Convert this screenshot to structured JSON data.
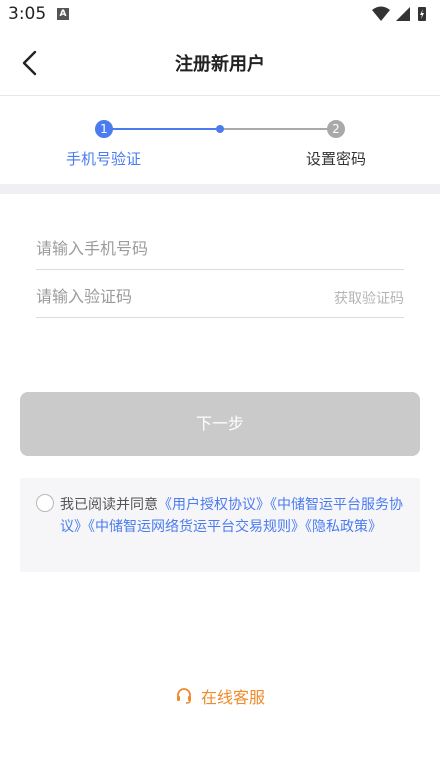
{
  "status": {
    "time": "3:05",
    "notif_letter": "A"
  },
  "nav": {
    "title": "注册新用户"
  },
  "steps": [
    {
      "number": "1",
      "label": "手机号验证"
    },
    {
      "number": "2",
      "label": "设置密码"
    }
  ],
  "form": {
    "phone_placeholder": "请输入手机号码",
    "code_placeholder": "请输入验证码",
    "get_code_label": "获取验证码",
    "next_label": "下一步"
  },
  "agreement": {
    "prefix": "我已阅读并同意",
    "link1": "《用户授权协议》",
    "link2": "《中储智运平台服务协议》",
    "link3": "《中储智运网络货运平台交易规则》",
    "link4": "《隐私政策》"
  },
  "service": {
    "label": "在线客服"
  },
  "colors": {
    "accent": "#4a7cf0",
    "inactive": "#a9a9a9",
    "service": "#f08a2a",
    "button_disabled": "#cacaca"
  }
}
